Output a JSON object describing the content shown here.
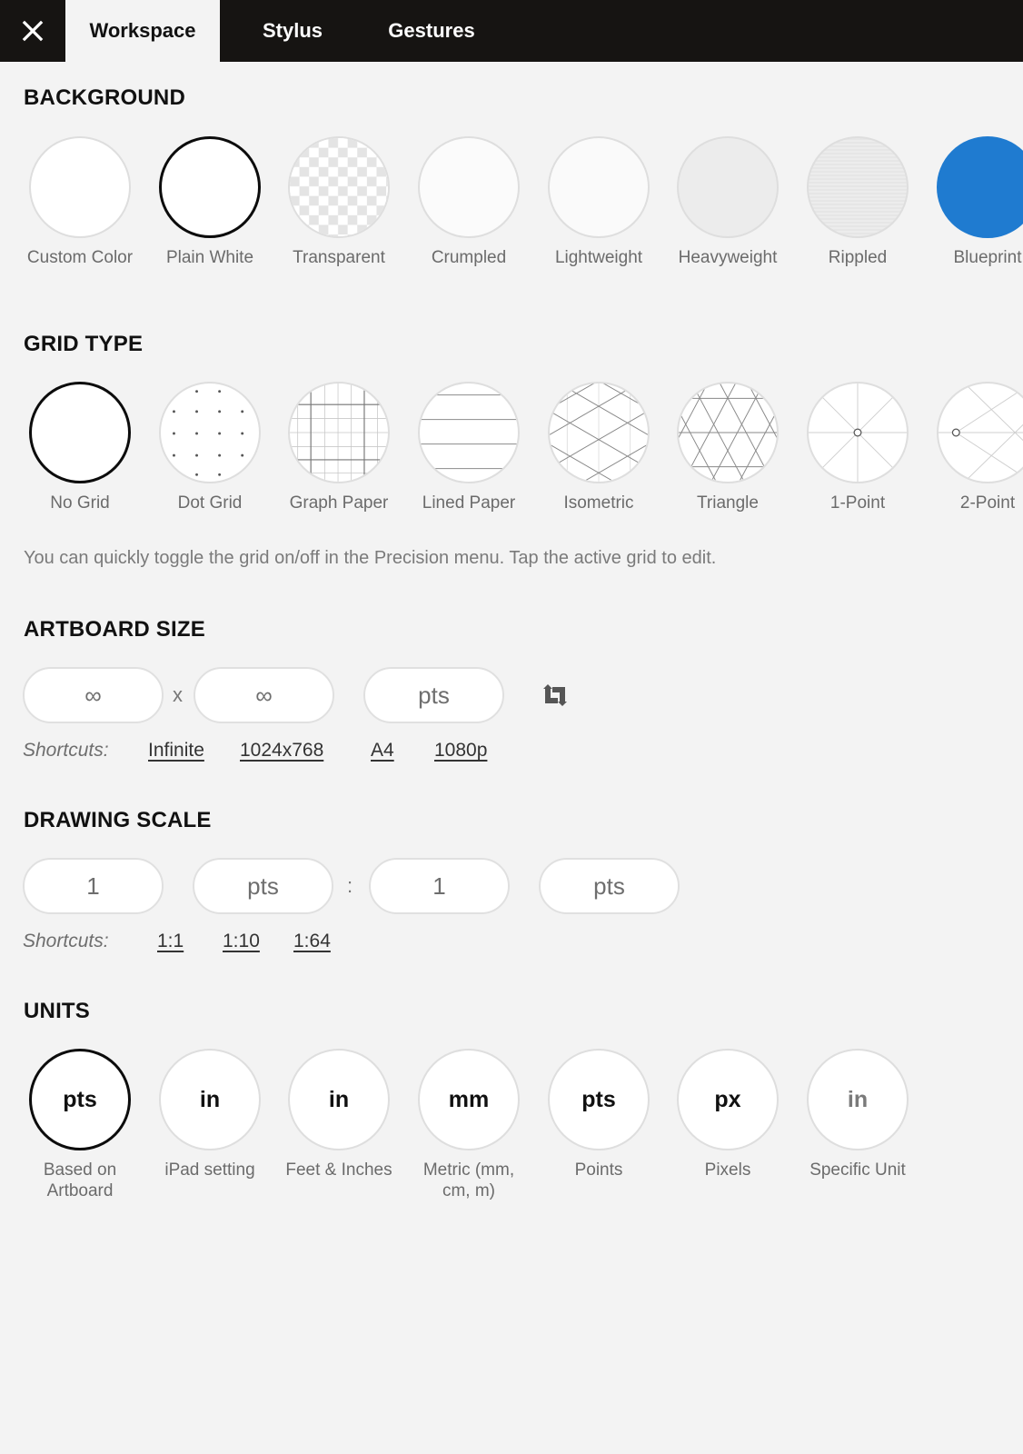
{
  "topbar": {
    "close_icon": "close-icon",
    "tabs": [
      {
        "label": "Workspace",
        "active": true
      },
      {
        "label": "Stylus",
        "active": false
      },
      {
        "label": "Gestures",
        "active": false
      }
    ]
  },
  "background": {
    "title": "BACKGROUND",
    "selected": "Plain White",
    "options": [
      {
        "label": "Custom Color",
        "fill": "#ffffff"
      },
      {
        "label": "Plain White",
        "fill": "#ffffff"
      },
      {
        "label": "Transparent",
        "fill": "checkerboard"
      },
      {
        "label": "Crumpled",
        "fill": "#fbfbfb"
      },
      {
        "label": "Lightweight",
        "fill": "#fafafa"
      },
      {
        "label": "Heavyweight",
        "fill": "#ececec"
      },
      {
        "label": "Rippled",
        "fill": "#ebebeb"
      },
      {
        "label": "Blueprint",
        "fill": "#1f7bd0"
      }
    ]
  },
  "grid_type": {
    "title": "GRID TYPE",
    "selected": "No Grid",
    "options": [
      {
        "label": "No Grid",
        "icon": "no-grid-icon"
      },
      {
        "label": "Dot Grid",
        "icon": "dot-grid-icon"
      },
      {
        "label": "Graph Paper",
        "icon": "graph-paper-icon"
      },
      {
        "label": "Lined Paper",
        "icon": "lined-paper-icon"
      },
      {
        "label": "Isometric",
        "icon": "isometric-icon"
      },
      {
        "label": "Triangle",
        "icon": "triangle-grid-icon"
      },
      {
        "label": "1-Point",
        "icon": "one-point-perspective-icon"
      },
      {
        "label": "2-Point",
        "icon": "two-point-perspective-icon"
      }
    ],
    "hint": "You can quickly toggle the grid on/off in the Precision menu. Tap the active grid to edit."
  },
  "artboard_size": {
    "title": "ARTBOARD SIZE",
    "width_value": "∞",
    "separator": "x",
    "height_value": "∞",
    "unit_value": "pts",
    "swap_icon": "swap-orientation-icon",
    "shortcuts_label": "Shortcuts:",
    "shortcuts": [
      "Infinite",
      "1024x768",
      "A4",
      "1080p"
    ]
  },
  "drawing_scale": {
    "title": "DRAWING SCALE",
    "left_value": "1",
    "left_unit": "pts",
    "separator": ":",
    "right_value": "1",
    "right_unit": "pts",
    "shortcuts_label": "Shortcuts:",
    "shortcuts": [
      "1:1",
      "1:10",
      "1:64"
    ]
  },
  "units": {
    "title": "UNITS",
    "selected": "Based on Artboard",
    "options": [
      {
        "unit": "pts",
        "label": "Based on Artboard"
      },
      {
        "unit": "in",
        "label": "iPad setting"
      },
      {
        "unit": "in",
        "label": "Feet & Inches"
      },
      {
        "unit": "mm",
        "label": "Metric (mm, cm, m)"
      },
      {
        "unit": "pts",
        "label": "Points"
      },
      {
        "unit": "px",
        "label": "Pixels"
      },
      {
        "unit": "in",
        "label": "Specific Unit"
      }
    ]
  }
}
